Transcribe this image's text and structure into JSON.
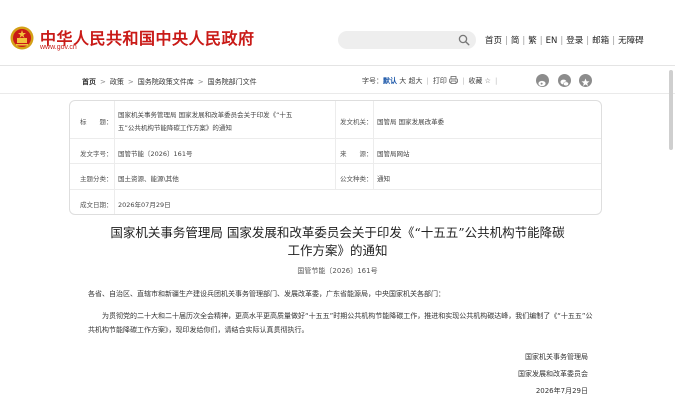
{
  "header": {
    "site_title": "中华人民共和国中央人民政府",
    "site_url": "www.gov.cn",
    "search_placeholder": "",
    "nav": [
      "首页",
      "简",
      "繁",
      "EN",
      "登录",
      "邮箱",
      "无障碍"
    ]
  },
  "breadcrumb": [
    "首页",
    "政策",
    "国务院政策文件库",
    "国务院部门文件"
  ],
  "toolbar": {
    "font_size_label": "字号：",
    "font_default": "默认",
    "font_large": "大",
    "font_xlarge": "超大",
    "print": "打印",
    "favorite": "收藏",
    "social_icons": [
      "weibo-icon",
      "wechat-icon",
      "qzone-icon"
    ]
  },
  "info": {
    "title_label": "标　　题：",
    "title_value_line1": "国家机关事务管理局  国家发展和改革委员会关于印发《“十五",
    "title_value_line2": "五”公共机构节能降碳工作方案》的通知",
    "issuer_label": "发文机关：",
    "issuer_value": "国管局  国家发展改革委",
    "number_label": "发文字号：",
    "number_value": "国管节能〔2026〕161号",
    "source_label": "来　　源：",
    "source_value": "国管局网站",
    "topic_label": "主题分类：",
    "topic_value": "国土资源、能源\\其他",
    "type_label": "公文种类：",
    "type_value": "通知",
    "date_label": "成文日期：",
    "date_value": "2026年07月29日"
  },
  "article": {
    "title_line1": "国家机关事务管理局  国家发展和改革委员会关于印发《“十五五”公共机构节能降碳",
    "title_line2": "工作方案》的通知",
    "doc_number": "国管节能〔2026〕161号",
    "addressee": "各省、自治区、直辖市和新疆生产建设兵团机关事务管理部门、发展改革委，广东省能源局，中央国家机关各部门：",
    "body": "为贯彻党的二十大和二十届历次全会精神，更高水平更高质量做好“十五五”时期公共机构节能降碳工作，推进和实现公共机构碳达峰，我们编制了《“十五五”公共机构节能降碳工作方案》，现印发给你们，请结合实际认真贯彻执行。",
    "signer1": "国家机关事务管理局",
    "signer2": "国家发展和改革委员会",
    "sign_date": "2026年7月29日"
  },
  "colors": {
    "brand_red": "#c91a17",
    "link_blue": "#1a56a8"
  }
}
